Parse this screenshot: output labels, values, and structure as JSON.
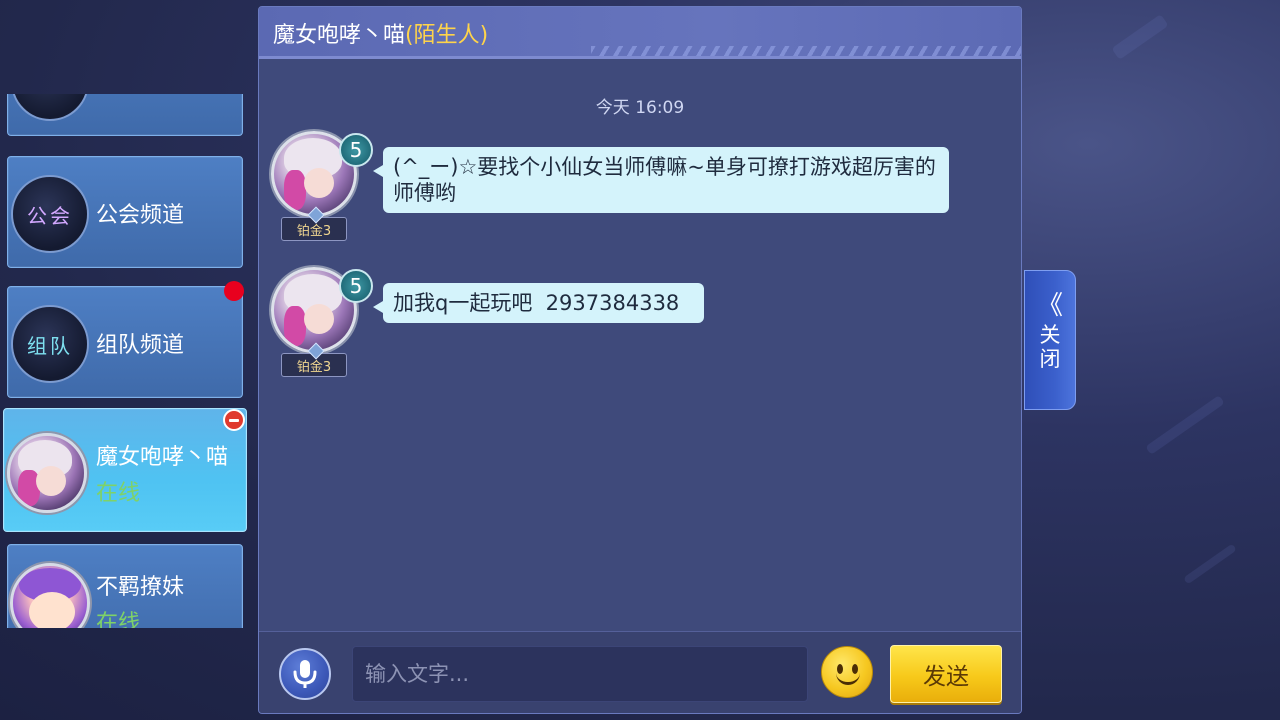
{
  "sidebar": {
    "items": [
      {
        "label": "",
        "badge_text": ""
      },
      {
        "label": "公会频道",
        "badge_text": "公会"
      },
      {
        "label": "组队频道",
        "badge_text": "组队"
      },
      {
        "name": "魔女咆哮丶喵",
        "status": "在线"
      },
      {
        "name": "不羁撩妹",
        "status": "在线"
      }
    ]
  },
  "chat": {
    "title": "魔女咆哮丶喵",
    "title_tag": "(陌生人)",
    "timestamp": "今天 16:09",
    "messages": [
      {
        "level": "5",
        "rank": "铂金3",
        "text": "(^_ー)☆要找个小仙女当师傅嘛~单身可撩打游戏超厉害的师傅哟"
      },
      {
        "level": "5",
        "rank": "铂金3",
        "text": "加我q一起玩吧  2937384338"
      }
    ],
    "input": {
      "placeholder": "输入文字...",
      "value": ""
    },
    "send_label": "发送"
  },
  "close_tab": {
    "chevron": "《",
    "label": "关闭"
  },
  "icons": {
    "mic": "microphone-icon",
    "emoji": "smiley-face-icon",
    "chevron": "double-chevron-left-icon"
  },
  "colors": {
    "stranger_tag": "#ffd44a",
    "online_status": "#84e36c",
    "send_button": "#f7c91a",
    "notification_dot": "#e8001e",
    "bubble": "#d4f3fb"
  }
}
